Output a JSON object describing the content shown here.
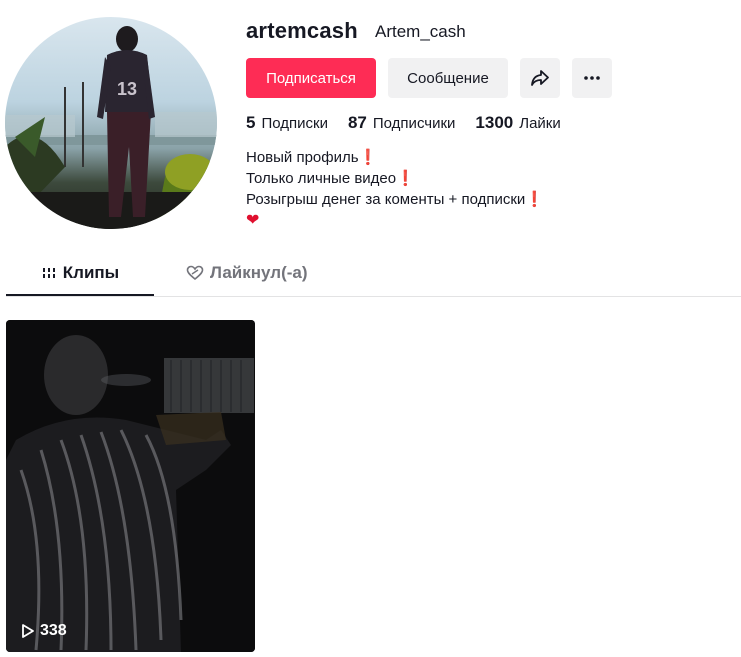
{
  "profile": {
    "username": "artemcash",
    "nickname": "Artem_cash"
  },
  "actions": {
    "follow": "Подписаться",
    "message": "Сообщение",
    "share_icon": "share-arrow-icon",
    "more_icon": "more-dots-icon"
  },
  "stats": {
    "following": {
      "value": "5",
      "label": "Подписки"
    },
    "followers": {
      "value": "87",
      "label": "Подписчики"
    },
    "likes": {
      "value": "1300",
      "label": "Лайки"
    }
  },
  "bio": {
    "line1": "Новый профиль",
    "line2": "Только личные видео",
    "line3": "Розыгрыш денег за коменты + подписки",
    "mark": "❗",
    "heart": "❤"
  },
  "tabs": [
    {
      "label": "Клипы",
      "icon": "grid-lines-icon",
      "active": true
    },
    {
      "label": "Лайкнул(-а)",
      "icon": "liked-heart-icon",
      "active": false
    }
  ],
  "videos": [
    {
      "views": "338",
      "icon": "play-outline-icon"
    }
  ],
  "colors": {
    "accent": "#fe2c55",
    "button_bg": "#f1f1f2",
    "text": "#161823",
    "muted": "#73747b"
  }
}
